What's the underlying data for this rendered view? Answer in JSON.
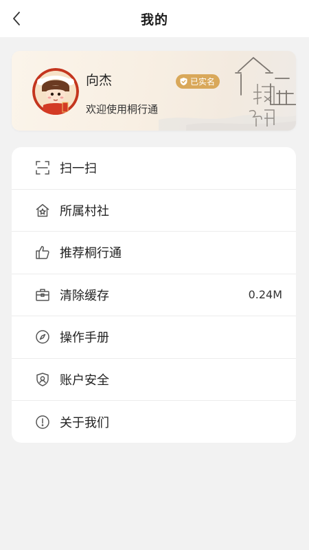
{
  "header": {
    "title": "我的",
    "back_icon": "chevron-left-icon"
  },
  "profile": {
    "name": "向杰",
    "badge_label": "已实名",
    "badge_icon": "shield-check-icon",
    "welcome": "欢迎使用桐行通",
    "deco_text": "桐乡"
  },
  "menu": {
    "items": [
      {
        "label": "扫一扫",
        "icon": "scan-icon",
        "value": ""
      },
      {
        "label": "所属村社",
        "icon": "home-icon",
        "value": ""
      },
      {
        "label": "推荐桐行通",
        "icon": "thumbs-up-icon",
        "value": ""
      },
      {
        "label": "清除缓存",
        "icon": "toolbox-icon",
        "value": "0.24M"
      },
      {
        "label": "操作手册",
        "icon": "compass-icon",
        "value": ""
      },
      {
        "label": "账户安全",
        "icon": "shield-user-icon",
        "value": ""
      },
      {
        "label": "关于我们",
        "icon": "info-icon",
        "value": ""
      }
    ]
  },
  "colors": {
    "accent": "#d9a85a",
    "background": "#f2f2f2"
  }
}
